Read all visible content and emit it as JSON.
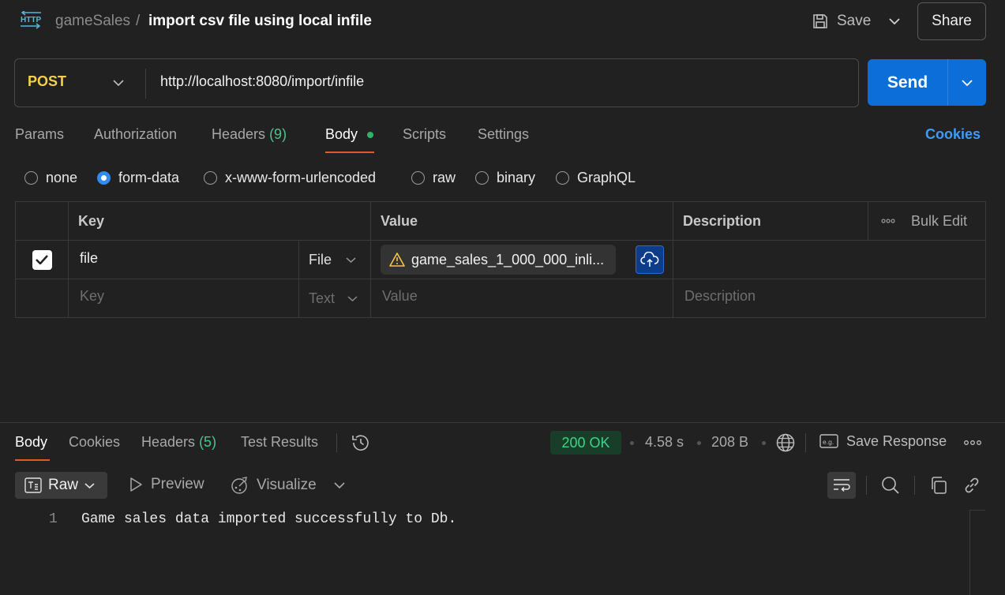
{
  "breadcrumb": {
    "collection": "gameSales",
    "separator": "/",
    "request": "import csv file using local infile"
  },
  "toolbar": {
    "save_label": "Save",
    "share_label": "Share"
  },
  "request": {
    "method": "POST",
    "url": "http://localhost:8080/import/infile",
    "send_label": "Send"
  },
  "tabs": {
    "params": "Params",
    "authorization": "Authorization",
    "headers": "Headers",
    "headers_count": "(9)",
    "body": "Body",
    "scripts": "Scripts",
    "settings": "Settings",
    "cookies": "Cookies"
  },
  "body_types": [
    "none",
    "form-data",
    "x-www-form-urlencoded",
    "raw",
    "binary",
    "GraphQL"
  ],
  "body_type_selected": "form-data",
  "table": {
    "headers": {
      "key": "Key",
      "value": "Value",
      "description": "Description",
      "bulk_edit": "Bulk Edit"
    },
    "rows": [
      {
        "checked": true,
        "key": "file",
        "type": "File",
        "value": "game_sales_1_000_000_inli..."
      }
    ],
    "placeholder": {
      "key": "Key",
      "type": "Text",
      "value": "Value",
      "description": "Description"
    }
  },
  "response": {
    "tabs": {
      "body": "Body",
      "cookies": "Cookies",
      "headers": "Headers",
      "headers_count": "(5)",
      "tests": "Test Results"
    },
    "status": "200 OK",
    "time": "4.58 s",
    "size": "208 B",
    "save_response": "Save Response",
    "format": "Raw",
    "preview": "Preview",
    "visualize": "Visualize",
    "lines": [
      {
        "number": "1",
        "text": "Game sales data imported successfully to Db."
      }
    ]
  },
  "colors": {
    "accent": "#0c6ed8",
    "method": "#f5d04d",
    "status_ok": "#3ed486",
    "active_tab": "#e05a2b",
    "count": "#4cc38a",
    "link": "#3b9bff"
  }
}
